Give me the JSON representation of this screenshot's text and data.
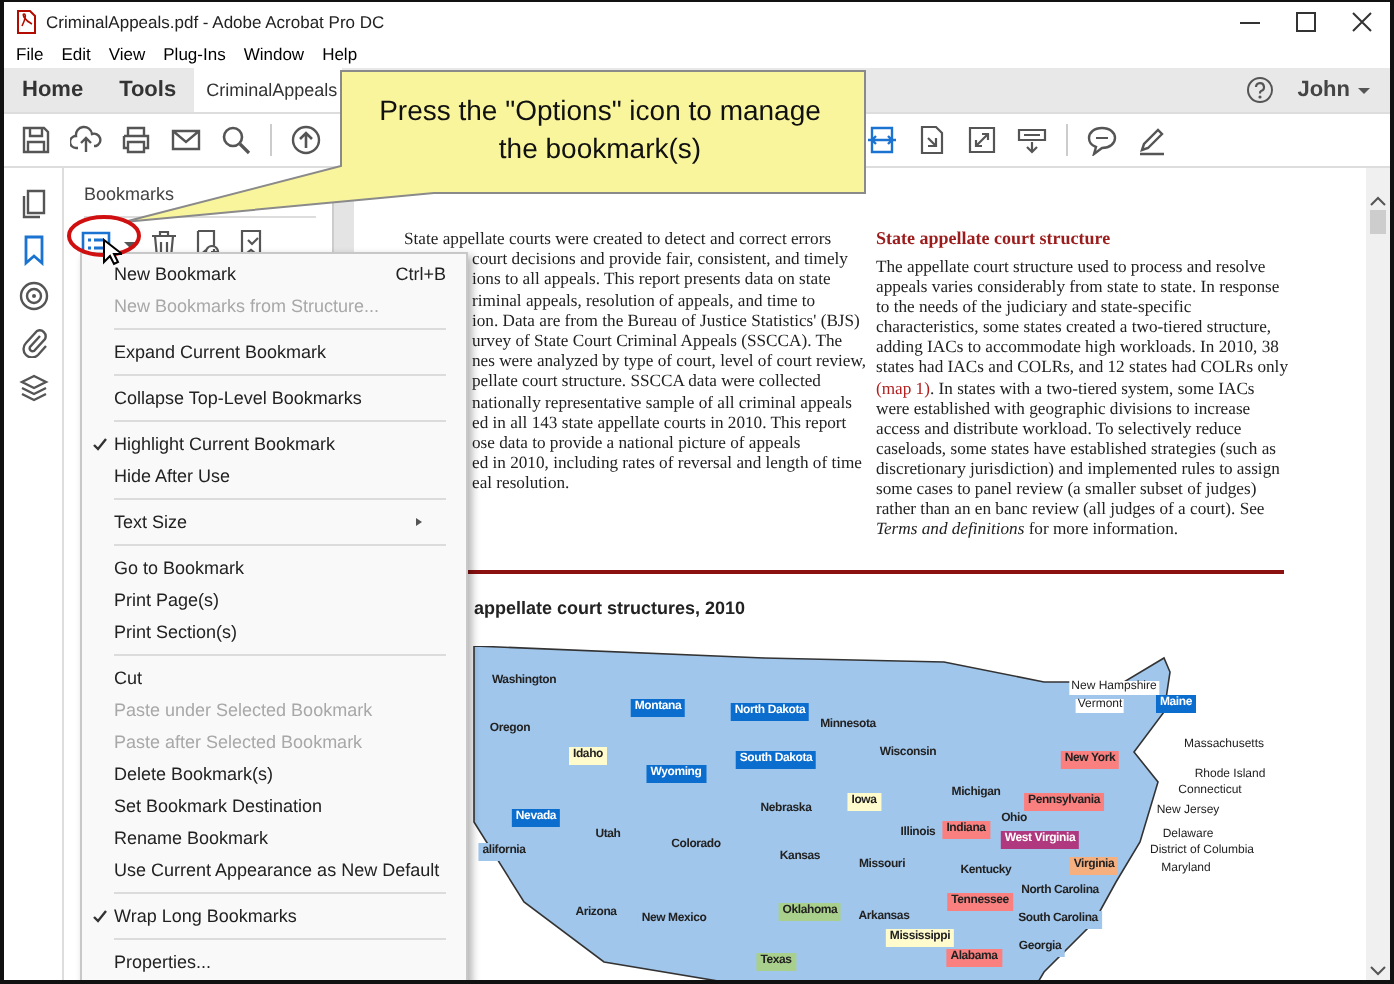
{
  "window": {
    "title": "CriminalAppeals.pdf - Adobe Acrobat Pro DC"
  },
  "menu_bar": [
    "File",
    "Edit",
    "View",
    "Plug-Ins",
    "Window",
    "Help"
  ],
  "tabs": [
    {
      "label": "Home",
      "selected": false
    },
    {
      "label": "Tools",
      "selected": false
    },
    {
      "label": "CriminalAppeals",
      "selected": true
    }
  ],
  "user": {
    "name": "John"
  },
  "side_rail": [
    {
      "kind": "pages",
      "selected": false
    },
    {
      "kind": "bookmarks",
      "selected": true
    },
    {
      "kind": "target",
      "selected": false
    },
    {
      "kind": "attachments",
      "selected": false
    },
    {
      "kind": "layers",
      "selected": false
    }
  ],
  "bookmarks_panel": {
    "title": "Bookmarks"
  },
  "callout": {
    "text": "Press the \"Options\" icon to manage the bookmark(s)"
  },
  "context_menu": [
    {
      "kind": "item",
      "label": "New Bookmark",
      "shortcut": "Ctrl+B",
      "disabled": false,
      "checked": false
    },
    {
      "kind": "item",
      "label": "New Bookmarks from Structure...",
      "disabled": true,
      "checked": false
    },
    {
      "kind": "separator"
    },
    {
      "kind": "item",
      "label": "Expand Current Bookmark",
      "disabled": false,
      "checked": false
    },
    {
      "kind": "separator"
    },
    {
      "kind": "item",
      "label": "Collapse Top-Level Bookmarks",
      "disabled": false,
      "checked": false
    },
    {
      "kind": "separator"
    },
    {
      "kind": "item",
      "label": "Highlight Current Bookmark",
      "disabled": false,
      "checked": true
    },
    {
      "kind": "item",
      "label": "Hide After Use",
      "disabled": false,
      "checked": false
    },
    {
      "kind": "separator"
    },
    {
      "kind": "submenu",
      "label": "Text Size",
      "disabled": false,
      "checked": false
    },
    {
      "kind": "separator"
    },
    {
      "kind": "item",
      "label": "Go to Bookmark",
      "disabled": false,
      "checked": false
    },
    {
      "kind": "item",
      "label": "Print Page(s)",
      "disabled": false,
      "checked": false
    },
    {
      "kind": "item",
      "label": "Print Section(s)",
      "disabled": false,
      "checked": false
    },
    {
      "kind": "separator"
    },
    {
      "kind": "item",
      "label": "Cut",
      "disabled": false,
      "checked": false
    },
    {
      "kind": "item",
      "label": "Paste under Selected Bookmark",
      "disabled": true,
      "checked": false
    },
    {
      "kind": "item",
      "label": "Paste after Selected Bookmark",
      "disabled": true,
      "checked": false
    },
    {
      "kind": "item",
      "label": "Delete Bookmark(s)",
      "disabled": false,
      "checked": false
    },
    {
      "kind": "item",
      "label": "Set Bookmark Destination",
      "disabled": false,
      "checked": false
    },
    {
      "kind": "item",
      "label": "Rename Bookmark",
      "disabled": false,
      "checked": false
    },
    {
      "kind": "item",
      "label": "Use Current Appearance as New Default",
      "disabled": false,
      "checked": false
    },
    {
      "kind": "separator"
    },
    {
      "kind": "item",
      "label": "Wrap Long Bookmarks",
      "disabled": false,
      "checked": true
    },
    {
      "kind": "separator"
    },
    {
      "kind": "item",
      "label": "Properties...",
      "disabled": false,
      "checked": false
    }
  ],
  "document": {
    "left_lines": [
      "State appellate courts were created to detect and correct errors",
      "court decisions and provide fair, consistent, and timely",
      "ions to all appeals. This report presents data on state",
      "riminal appeals, resolution of appeals, and time to",
      "ion. Data are from the Bureau of Justice Statistics' (BJS)",
      "urvey of State Court Criminal Appeals (SSCCA). The",
      "nes were analyzed by type of court, level of court review,",
      "pellate court structure. SSCCA data were collected",
      "nationally representative sample of all criminal appeals",
      "ed in all 143 state appellate courts in 2010. This report",
      "ose data to provide a national picture of appeals",
      "ed in 2010, including rates of reversal and length of time",
      "eal resolution."
    ],
    "right_heading": "State appellate court structure",
    "right_paragraph": {
      "before": "The appellate court structure used to process and resolve appeals varies considerably from state to state. In response to the needs of the judiciary and state-specific characteristics, some states created a two-tiered structure, adding IACs to accommodate high workloads. In 2010, 38 states had IACs and COLRs, and 12 states had COLRs only ",
      "link": "(map 1)",
      "after": ". In states with a two-tiered system, some IACs were established with geographic divisions to increase access and distribute workload. To selectively reduce caseloads, some states have established strategies (such as discretionary jurisdiction) and implemented rules to assign some cases to panel review (a smaller subset of judges) rather than an en banc review (all judges of a court). See *Terms and definitions* for more information."
    },
    "map_title": "appellate court structures, 2010",
    "map_labels": [
      {
        "kind": "inside",
        "name": "Washington",
        "color": "#a0c6ec"
      },
      {
        "kind": "inside",
        "name": "Oregon",
        "color": "#a0c6ec"
      },
      {
        "kind": "inside",
        "name": "Idaho",
        "color": "#fffbcc"
      },
      {
        "kind": "inside",
        "name": "Montana",
        "color": "#0b6dce"
      },
      {
        "kind": "inside",
        "name": "North Dakota",
        "color": "#0b6dce"
      },
      {
        "kind": "inside",
        "name": "South Dakota",
        "color": "#0b6dce"
      },
      {
        "kind": "inside",
        "name": "Wyoming",
        "color": "#0b6dce"
      },
      {
        "kind": "inside",
        "name": "Nevada",
        "color": "#0b6dce"
      },
      {
        "kind": "inside",
        "name": "alifornia",
        "color": "#a0c6ec"
      },
      {
        "kind": "inside",
        "name": "Utah",
        "color": "#a0c6ec"
      },
      {
        "kind": "inside",
        "name": "Colorado",
        "color": "#a0c6ec"
      },
      {
        "kind": "inside",
        "name": "Nebraska",
        "color": "#a0c6ec"
      },
      {
        "kind": "inside",
        "name": "Kansas",
        "color": "#a0c6ec"
      },
      {
        "kind": "inside",
        "name": "Minnesota",
        "color": "#a0c6ec"
      },
      {
        "kind": "inside",
        "name": "Iowa",
        "color": "#fffbcc"
      },
      {
        "kind": "inside",
        "name": "Wisconsin",
        "color": "#a0c6ec"
      },
      {
        "kind": "inside",
        "name": "Michigan",
        "color": "#a0c6ec"
      },
      {
        "kind": "inside",
        "name": "Illinois",
        "color": "#a0c6ec"
      },
      {
        "kind": "inside",
        "name": "Missouri",
        "color": "#a0c6ec"
      },
      {
        "kind": "inside",
        "name": "Indiana",
        "color": "#fa8080"
      },
      {
        "kind": "inside",
        "name": "Ohio",
        "color": "#a0c6ec"
      },
      {
        "kind": "inside",
        "name": "Kentucky",
        "color": "#a0c6ec"
      },
      {
        "kind": "inside",
        "name": "West Virginia",
        "color": "#b0387e"
      },
      {
        "kind": "inside",
        "name": "Virginia",
        "color": "#f6b080"
      },
      {
        "kind": "inside",
        "name": "Tennessee",
        "color": "#fa8080"
      },
      {
        "kind": "inside",
        "name": "North Carolina",
        "color": "#a0c6ec"
      },
      {
        "kind": "inside",
        "name": "South Carolina",
        "color": "#a0c6ec"
      },
      {
        "kind": "inside",
        "name": "Alabama",
        "color": "#fa8080"
      },
      {
        "kind": "inside",
        "name": "Georgia",
        "color": "#a0c6ec"
      },
      {
        "kind": "inside",
        "name": "Mississippi",
        "color": "#fffbcc"
      },
      {
        "kind": "inside",
        "name": "Arkansas",
        "color": "#a0c6ec"
      },
      {
        "kind": "inside",
        "name": "Oklahoma",
        "color": "#a8d08c"
      },
      {
        "kind": "inside",
        "name": "Texas",
        "color": "#a8d08c"
      },
      {
        "kind": "inside",
        "name": "New Mexico",
        "color": "#a0c6ec"
      },
      {
        "kind": "inside",
        "name": "Arizona",
        "color": "#a0c6ec"
      },
      {
        "kind": "inside",
        "name": "New York",
        "color": "#fa8080"
      },
      {
        "kind": "inside",
        "name": "Pennsylvania",
        "color": "#fa8080"
      },
      {
        "kind": "outside",
        "name": "New Hampshire"
      },
      {
        "kind": "outside",
        "name": "Vermont"
      },
      {
        "kind": "inside",
        "name": "Maine",
        "color": "#0b6dce"
      },
      {
        "kind": "outside",
        "name": "Massachusetts"
      },
      {
        "kind": "outside",
        "name": "Rhode Island"
      },
      {
        "kind": "outside",
        "name": "Connecticut"
      },
      {
        "kind": "outside",
        "name": "New Jersey"
      },
      {
        "kind": "outside",
        "name": "Delaware"
      },
      {
        "kind": "outside",
        "name": "District of Columbia"
      },
      {
        "kind": "outside",
        "name": "Maryland"
      }
    ]
  }
}
